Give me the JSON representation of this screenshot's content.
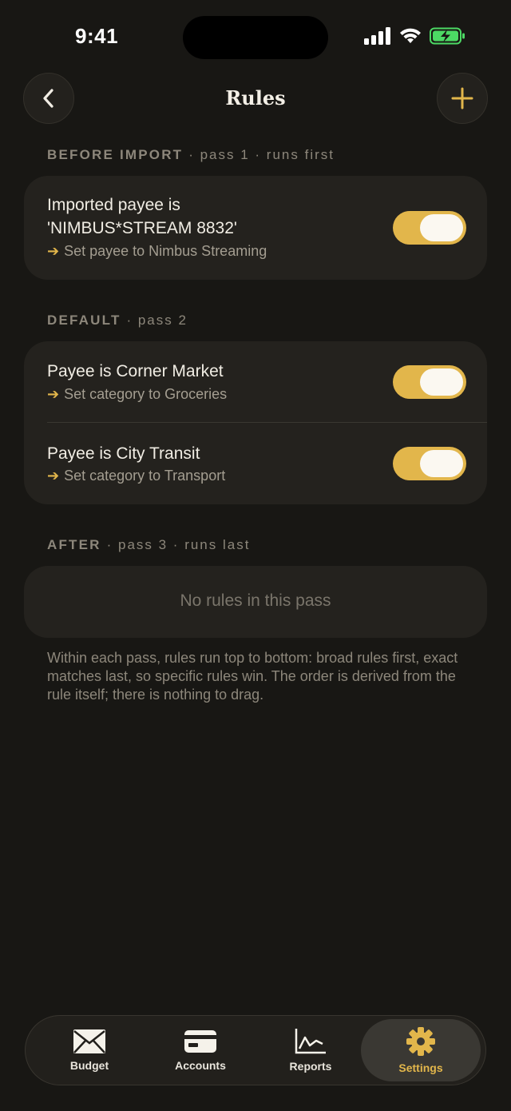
{
  "status": {
    "time": "9:41"
  },
  "nav": {
    "title": "Rules"
  },
  "sections": [
    {
      "title": "BEFORE IMPORT",
      "meta": "· pass 1 · runs first"
    },
    {
      "title": "DEFAULT",
      "meta": "· pass 2"
    },
    {
      "title": "AFTER",
      "meta": "· pass 3 · runs last"
    }
  ],
  "rules": [
    {
      "condition_line1": "Imported payee is",
      "condition_line2": "'NIMBUS*STREAM 8832'",
      "action": "Set payee to Nimbus Streaming",
      "enabled": true
    },
    {
      "condition": "Payee is Corner Market",
      "action": "Set category to Groceries",
      "enabled": true
    },
    {
      "condition": "Payee is City Transit",
      "action": "Set category to Transport",
      "enabled": true
    }
  ],
  "empty": {
    "text": "No rules in this pass"
  },
  "footnote": "Within each pass, rules run top to bottom: broad rules first, exact matches last, so specific rules win. The order is derived from the rule itself; there is nothing to drag.",
  "tabs": [
    {
      "label": "Budget",
      "icon": "envelope-icon"
    },
    {
      "label": "Accounts",
      "icon": "card-icon"
    },
    {
      "label": "Reports",
      "icon": "chart-icon"
    },
    {
      "label": "Settings",
      "icon": "gear-icon",
      "active": true
    }
  ],
  "colors": {
    "accent": "#e2b64b",
    "background": "#181714",
    "card": "#24221e",
    "battery": "#4cd964"
  }
}
